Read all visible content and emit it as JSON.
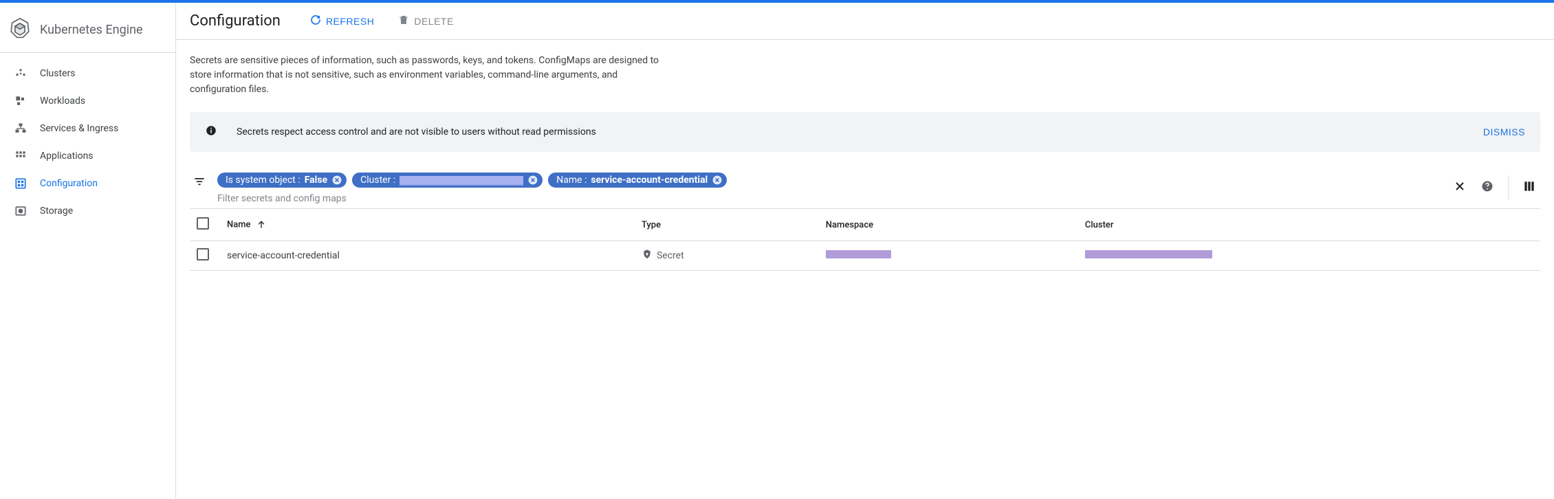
{
  "sidebar": {
    "title": "Kubernetes Engine",
    "items": [
      {
        "label": "Clusters"
      },
      {
        "label": "Workloads"
      },
      {
        "label": "Services & Ingress"
      },
      {
        "label": "Applications"
      },
      {
        "label": "Configuration",
        "active": true
      },
      {
        "label": "Storage"
      }
    ]
  },
  "header": {
    "title": "Configuration",
    "refresh": "REFRESH",
    "delete": "DELETE"
  },
  "description": "Secrets are sensitive pieces of information, such as passwords, keys, and tokens. ConfigMaps are designed to store information that is not sensitive, such as environment variables, command-line arguments, and configuration files.",
  "banner": {
    "text": "Secrets respect access control and are not visible to users without read permissions",
    "dismiss": "DISMISS"
  },
  "filter": {
    "placeholder": "Filter secrets and config maps",
    "chips": [
      {
        "label": "Is system object : ",
        "value": "False"
      },
      {
        "label": "Cluster : ",
        "redacted": true
      },
      {
        "label": "Name : ",
        "value": "service-account-credential"
      }
    ]
  },
  "table": {
    "columns": [
      "Name",
      "Type",
      "Namespace",
      "Cluster"
    ],
    "rows": [
      {
        "name": "service-account-credential",
        "type": "Secret",
        "namespace_redacted": true,
        "cluster_redacted": true
      }
    ]
  }
}
